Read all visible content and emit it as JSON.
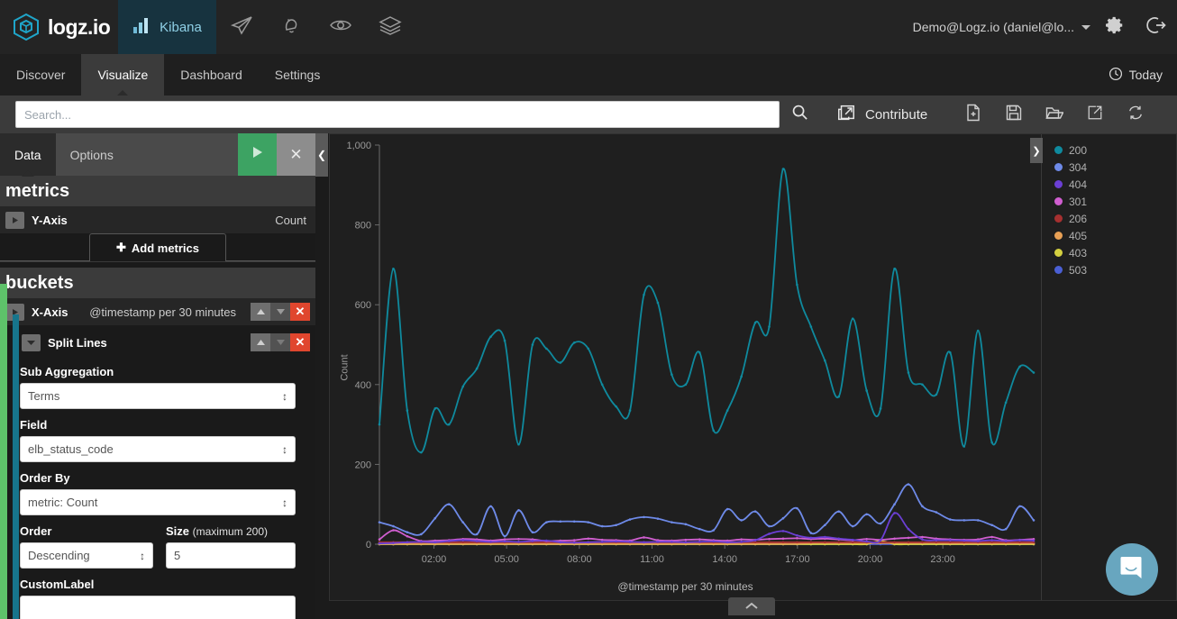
{
  "topbar": {
    "brand": "logz.io",
    "brand_icon": "logzio-cube-icon",
    "nav": [
      {
        "label": "Kibana",
        "icon": "bar-chart-icon",
        "active": true
      },
      {
        "label": "",
        "icon": "paper-plane-icon",
        "active": false
      },
      {
        "label": "",
        "icon": "bell-icon",
        "active": false
      },
      {
        "label": "",
        "icon": "eye-icon",
        "active": false
      },
      {
        "label": "",
        "icon": "layers-icon",
        "active": false
      }
    ],
    "user": "Demo@Logz.io (daniel@lo...",
    "settings_icon": "gear-icon",
    "logout_icon": "sign-out-icon"
  },
  "tabbar": {
    "tabs": [
      {
        "label": "Discover",
        "active": false
      },
      {
        "label": "Visualize",
        "active": true
      },
      {
        "label": "Dashboard",
        "active": false
      },
      {
        "label": "Settings",
        "active": false
      }
    ],
    "time_picker": {
      "label": "Today",
      "icon": "clock-icon"
    }
  },
  "searchrow": {
    "placeholder": "Search...",
    "value": "",
    "search_icon": "magnifier-icon",
    "contribute_label": "Contribute",
    "contribute_icon": "external-window-icon",
    "tools": [
      {
        "icon": "new-document-icon",
        "name": "new-visualization"
      },
      {
        "icon": "floppy-save-icon",
        "name": "save-visualization"
      },
      {
        "icon": "open-folder-icon",
        "name": "open-visualization"
      },
      {
        "icon": "share-arrow-icon",
        "name": "share-visualization"
      },
      {
        "icon": "refresh-icon",
        "name": "refresh-visualization"
      }
    ]
  },
  "editor": {
    "tabs": [
      {
        "label": "Data",
        "active": true
      },
      {
        "label": "Options",
        "active": false
      }
    ],
    "apply_icon": "play-triangle-icon",
    "discard_icon": "close-x-icon",
    "collapse_icon": "chevron-left-icon",
    "metrics": {
      "title": "metrics",
      "yaxis_label": "Y-Axis",
      "yaxis_value": "Count",
      "add_metrics_label": "Add metrics",
      "add_icon": "plus-icon"
    },
    "buckets": {
      "title": "buckets",
      "xaxis_label": "X-Axis",
      "xaxis_value": "@timestamp per 30 minutes",
      "split_label": "Split Lines",
      "up_icon": "arrow-up-icon",
      "down_icon": "arrow-down-icon",
      "delete_icon": "x-icon",
      "fields": {
        "sub_aggregation_label": "Sub Aggregation",
        "sub_aggregation_value": "Terms",
        "field_label": "Field",
        "field_value": "elb_status_code",
        "order_by_label": "Order By",
        "order_by_value": "metric: Count",
        "order_label": "Order",
        "order_value": "Descending",
        "size_label": "Size",
        "size_hint": "(maximum 200)",
        "size_value": "5",
        "custom_label_label": "CustomLabel",
        "custom_label_value": ""
      }
    }
  },
  "chart_data": {
    "type": "line",
    "title": "",
    "xlabel": "@timestamp per 30 minutes",
    "ylabel": "Count",
    "ylim": [
      0,
      1000
    ],
    "yticks": [
      0,
      200,
      400,
      600,
      800,
      1000
    ],
    "ytick_labels": [
      "0",
      "200",
      "400",
      "600",
      "800",
      "1,000"
    ],
    "xticks": [
      "02:00",
      "05:00",
      "08:00",
      "11:00",
      "14:00",
      "17:00",
      "20:00",
      "23:00"
    ],
    "xtick_positions": [
      0.0833,
      0.1944,
      0.3056,
      0.4167,
      0.5278,
      0.6389,
      0.75,
      0.8611
    ],
    "grid": false,
    "legend_position": "right",
    "interpolation": "smooth",
    "n_points": 48,
    "series": [
      {
        "name": "200",
        "color": "#0f8a9e",
        "values": [
          300,
          690,
          335,
          230,
          340,
          300,
          395,
          440,
          520,
          510,
          250,
          500,
          490,
          455,
          505,
          490,
          400,
          345,
          335,
          625,
          605,
          425,
          400,
          480,
          285,
          335,
          420,
          555,
          545,
          940,
          650,
          545,
          460,
          370,
          565,
          385,
          340,
          690,
          430,
          400,
          375,
          480,
          245,
          535,
          255,
          355,
          445,
          430
        ]
      },
      {
        "name": "304",
        "color": "#6e8ae8",
        "values": [
          55,
          45,
          30,
          25,
          65,
          100,
          55,
          25,
          95,
          20,
          85,
          30,
          55,
          57,
          57,
          55,
          45,
          48,
          62,
          68,
          64,
          55,
          50,
          38,
          35,
          88,
          60,
          82,
          45,
          65,
          90,
          28,
          48,
          82,
          45,
          75,
          52,
          100,
          150,
          95,
          80,
          62,
          60,
          60,
          48,
          38,
          95,
          60
        ]
      },
      {
        "name": "404",
        "color": "#6b3fd4",
        "values": [
          2,
          3,
          5,
          6,
          5,
          8,
          10,
          8,
          6,
          7,
          6,
          8,
          9,
          5,
          4,
          5,
          6,
          7,
          6,
          5,
          6,
          6,
          5,
          6,
          7,
          5,
          6,
          10,
          26,
          33,
          22,
          16,
          18,
          14,
          11,
          7,
          10,
          78,
          38,
          12,
          10,
          10,
          9,
          8,
          10,
          8,
          10,
          9
        ]
      },
      {
        "name": "301",
        "color": "#d05ed0",
        "values": [
          12,
          35,
          20,
          8,
          9,
          10,
          13,
          12,
          9,
          12,
          13,
          12,
          8,
          9,
          10,
          14,
          11,
          10,
          9,
          17,
          10,
          9,
          11,
          12,
          10,
          9,
          12,
          11,
          13,
          14,
          15,
          13,
          14,
          12,
          10,
          13,
          11,
          14,
          16,
          18,
          14,
          12,
          11,
          12,
          18,
          10,
          11,
          13
        ]
      },
      {
        "name": "206",
        "color": "#a63030",
        "values": [
          5,
          5,
          5,
          5,
          5,
          5,
          5,
          5,
          5,
          5,
          5,
          5,
          5,
          5,
          5,
          5,
          5,
          5,
          5,
          5,
          5,
          5,
          5,
          5,
          5,
          5,
          5,
          5,
          5,
          5,
          5,
          5,
          5,
          5,
          5,
          5,
          5,
          5,
          5,
          5,
          5,
          5,
          5,
          5,
          5,
          5,
          5,
          5
        ]
      },
      {
        "name": "405",
        "color": "#e8a055",
        "values": [
          1,
          1,
          1,
          1,
          1,
          1,
          1,
          1,
          1,
          1,
          1,
          1,
          1,
          1,
          1,
          1,
          1,
          1,
          1,
          1,
          1,
          1,
          1,
          1,
          1,
          1,
          1,
          1,
          1,
          1,
          1,
          3,
          3,
          3,
          3,
          3,
          3,
          3,
          3,
          3,
          3,
          2,
          2,
          2,
          2,
          2,
          2,
          2
        ]
      },
      {
        "name": "403",
        "color": "#d4d040",
        "values": [
          0,
          0,
          0,
          0,
          0,
          0,
          0,
          0,
          0,
          0,
          0,
          0,
          0,
          0,
          0,
          0,
          0,
          0,
          0,
          0,
          0,
          0,
          0,
          0,
          0,
          0,
          0,
          0,
          0,
          0,
          0,
          0,
          0,
          0,
          0,
          0,
          8,
          0,
          0,
          0,
          0,
          0,
          0,
          0,
          0,
          0,
          0,
          0
        ]
      },
      {
        "name": "503",
        "color": "#4a5fd4",
        "values": [
          0,
          0,
          0,
          0,
          0,
          0,
          0,
          0,
          0,
          0,
          0,
          0,
          0,
          0,
          0,
          0,
          0,
          0,
          0,
          0,
          0,
          0,
          0,
          0,
          0,
          0,
          0,
          0,
          0,
          0,
          0,
          0,
          0,
          0,
          0,
          0,
          0,
          0,
          0,
          0,
          0,
          0,
          0,
          0,
          0,
          0,
          0,
          0
        ]
      }
    ]
  },
  "legend": {
    "collapse_icon": "chevron-right-icon",
    "items": [
      {
        "label": "200",
        "color": "#0f8a9e"
      },
      {
        "label": "304",
        "color": "#6e8ae8"
      },
      {
        "label": "404",
        "color": "#6b3fd4"
      },
      {
        "label": "301",
        "color": "#d05ed0"
      },
      {
        "label": "206",
        "color": "#a63030"
      },
      {
        "label": "405",
        "color": "#e8a055"
      },
      {
        "label": "403",
        "color": "#d4d040"
      },
      {
        "label": "503",
        "color": "#4a5fd4"
      }
    ]
  },
  "bottom": {
    "expand_icon": "chevron-up-icon"
  },
  "chat": {
    "icon": "chat-bubble-icon",
    "color": "#68a6bf"
  }
}
